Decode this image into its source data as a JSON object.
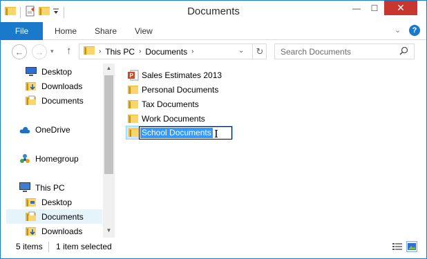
{
  "window": {
    "title": "Documents",
    "controls": {
      "minimize": "—",
      "maximize": "☐",
      "close": "✕"
    }
  },
  "ribbon": {
    "tabs": [
      {
        "label": "File"
      },
      {
        "label": "Home"
      },
      {
        "label": "Share"
      },
      {
        "label": "View"
      }
    ],
    "help_label": "?",
    "collapse_glyph": "⌄"
  },
  "navigation": {
    "back_glyph": "←",
    "forward_glyph": "→",
    "recent_glyph": "▾",
    "up_glyph": "↑",
    "breadcrumb": [
      "This PC",
      "Documents"
    ],
    "crumb_separator": "›",
    "dropdown_glyph": "⌄",
    "refresh_glyph": "↻",
    "search_placeholder": "Search Documents",
    "search_glyph": "⌕"
  },
  "sidebar": {
    "quick_access": [
      {
        "label": "Desktop",
        "icon": "desktop-icon"
      },
      {
        "label": "Downloads",
        "icon": "downloads-folder-icon"
      },
      {
        "label": "Documents",
        "icon": "documents-folder-icon"
      }
    ],
    "onedrive": {
      "label": "OneDrive",
      "icon": "cloud-icon"
    },
    "homegroup": {
      "label": "Homegroup",
      "icon": "homegroup-icon"
    },
    "this_pc": {
      "label": "This PC",
      "icon": "computer-icon",
      "children": [
        {
          "label": "Desktop",
          "icon": "desktop-folder-icon"
        },
        {
          "label": "Documents",
          "icon": "documents-folder-icon",
          "selected": true
        },
        {
          "label": "Downloads",
          "icon": "downloads-folder-icon"
        }
      ]
    },
    "scroll_up_glyph": "▲",
    "scroll_down_glyph": "▼"
  },
  "files": [
    {
      "label": "Sales Estimates 2013",
      "icon": "powerpoint-file-icon"
    },
    {
      "label": "Personal Documents",
      "icon": "folder-icon"
    },
    {
      "label": "Tax Documents",
      "icon": "folder-icon"
    },
    {
      "label": "Work Documents",
      "icon": "folder-icon"
    },
    {
      "label": "School Documents",
      "icon": "folder-icon",
      "renaming": true
    }
  ],
  "rename": {
    "value": "School Documents"
  },
  "cursor_glyph": "I",
  "status": {
    "item_count": "5 items",
    "selection": "1 item selected"
  },
  "colors": {
    "accent": "#1979ca",
    "close": "#c7372f",
    "selection_highlight": "#3399ff",
    "nav_selected": "#e5f3fb",
    "folder": "#e8b93b"
  }
}
